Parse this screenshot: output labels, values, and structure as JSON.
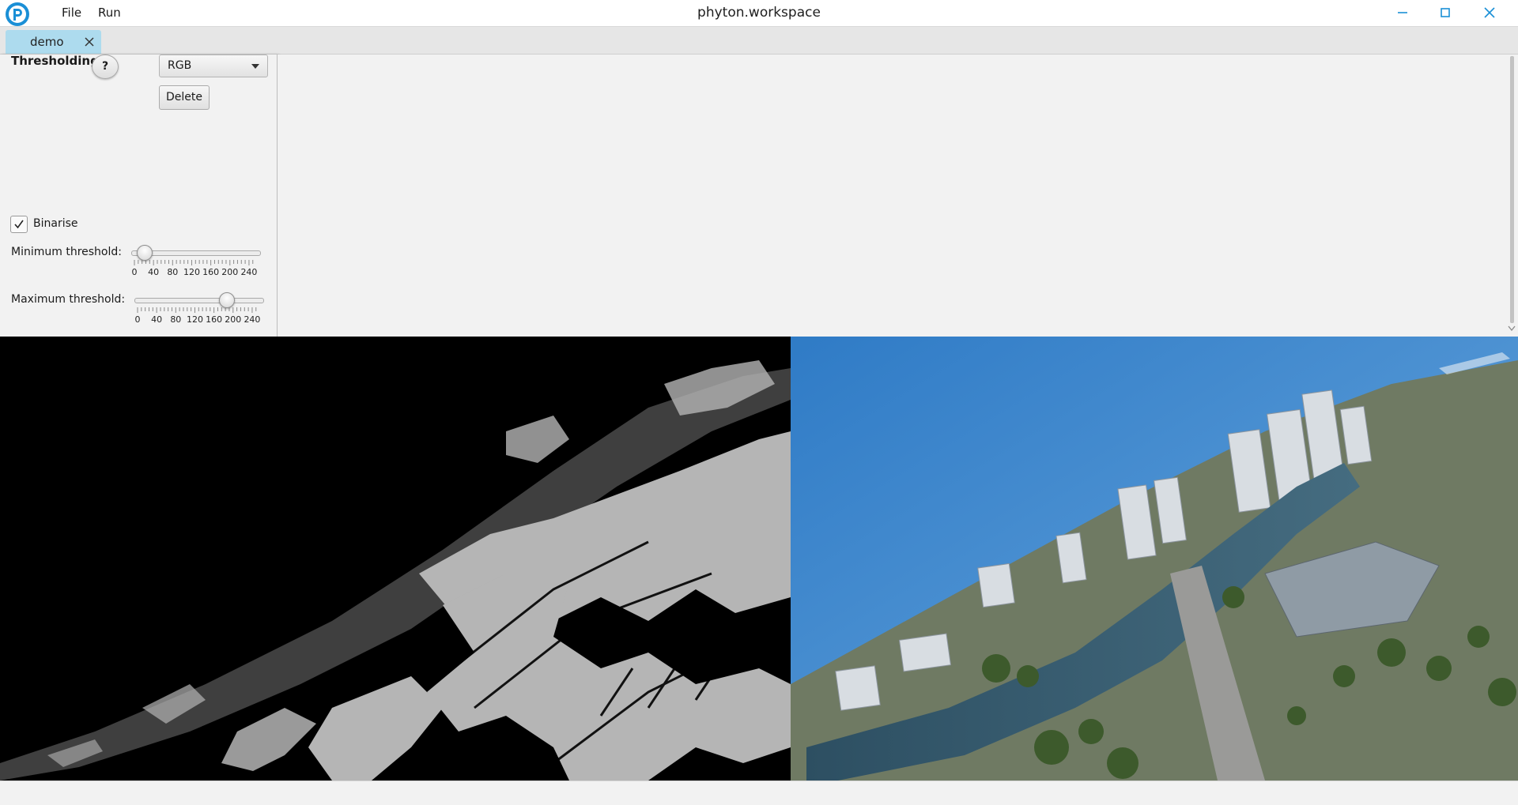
{
  "window": {
    "title": "phyton.workspace",
    "logo_icon": "app-logo-icon",
    "controls": [
      "minimize-icon",
      "maximize-icon",
      "close-icon"
    ],
    "accent_color": "#1a8fd6"
  },
  "menu": {
    "items": [
      {
        "label": "File"
      },
      {
        "label": "Run"
      }
    ]
  },
  "tabs": [
    {
      "label": "demo",
      "active": true,
      "color": "#addbee"
    }
  ],
  "panel": {
    "title": "Thresholding",
    "help_label": "?",
    "color_space": {
      "value": "RGB"
    },
    "delete_label": "Delete",
    "binarise": {
      "label": "Binarise",
      "checked": true
    },
    "min_threshold": {
      "label": "Minimum threshold:",
      "value": 20,
      "range": [
        0,
        255
      ],
      "scale": [
        "0",
        "40",
        "80",
        "120",
        "160",
        "200",
        "240"
      ]
    },
    "max_threshold": {
      "label": "Maximum threshold:",
      "value": 185,
      "range": [
        0,
        255
      ],
      "scale": [
        "0",
        "40",
        "80",
        "120",
        "160",
        "200",
        "240"
      ]
    }
  },
  "views": {
    "left": {
      "kind": "binary-threshold-output",
      "fg_color": "#b5b5b5",
      "bg_color": "#000000"
    },
    "right": {
      "kind": "source-photo-aerial-city",
      "sky_color": "#3f8ad0"
    }
  }
}
